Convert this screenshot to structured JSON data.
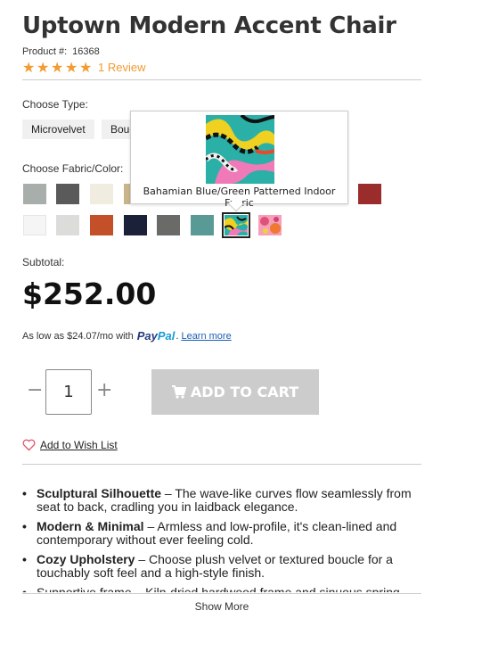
{
  "product": {
    "title": "Uptown Modern Accent Chair",
    "number_label": "Product #:",
    "number": "16368",
    "rating_stars": 5,
    "review_link": "1 Review"
  },
  "type": {
    "label": "Choose Type:",
    "options": [
      "Microvelvet",
      "Bouc"
    ]
  },
  "fabric": {
    "label": "Choose Fabric/Color:",
    "tooltip": "Bahamian Blue/Green Patterned Indoor Fabric",
    "swatch_colors_row1": [
      "#a8aeaa",
      "#5a5a5a",
      "#f0ece0",
      "#c9b48a",
      "#9b2c2c"
    ],
    "swatch_colors_row2": [
      "#f5f5f5",
      "#dcdcda",
      "#c4502a",
      "#1a2138",
      "#6a6a68",
      "#5a9a96",
      "#patterned",
      "#patterned-pink"
    ]
  },
  "pricing": {
    "subtotal_label": "Subtotal:",
    "price": "$252.00",
    "paypal_prefix": "As low as $24.07/mo with",
    "paypal_logo_1": "Pay",
    "paypal_logo_2": "Pal",
    "paypal_dot": ".",
    "learn_more": "Learn more"
  },
  "cart": {
    "quantity": "1",
    "minus": "−",
    "plus": "+",
    "add_to_cart": "ADD TO CART",
    "wishlist": "Add to Wish List"
  },
  "features": [
    {
      "bold": "Sculptural Silhouette",
      "text": " – The wave-like curves flow seamlessly from seat to back, cradling you in laidback elegance."
    },
    {
      "bold": "Modern & Minimal",
      "text": " – Armless and low-profile, it's clean-lined and contemporary without ever feeling cold."
    },
    {
      "bold": "Cozy Upholstery",
      "text": " – Choose plush velvet or textured boucle for a touchably soft feel and a high-style finish."
    },
    {
      "bold": "",
      "text": "Supportive frame – Kiln-dried hardwood frame and sinuous spring seating"
    }
  ],
  "show_more": "Show More"
}
